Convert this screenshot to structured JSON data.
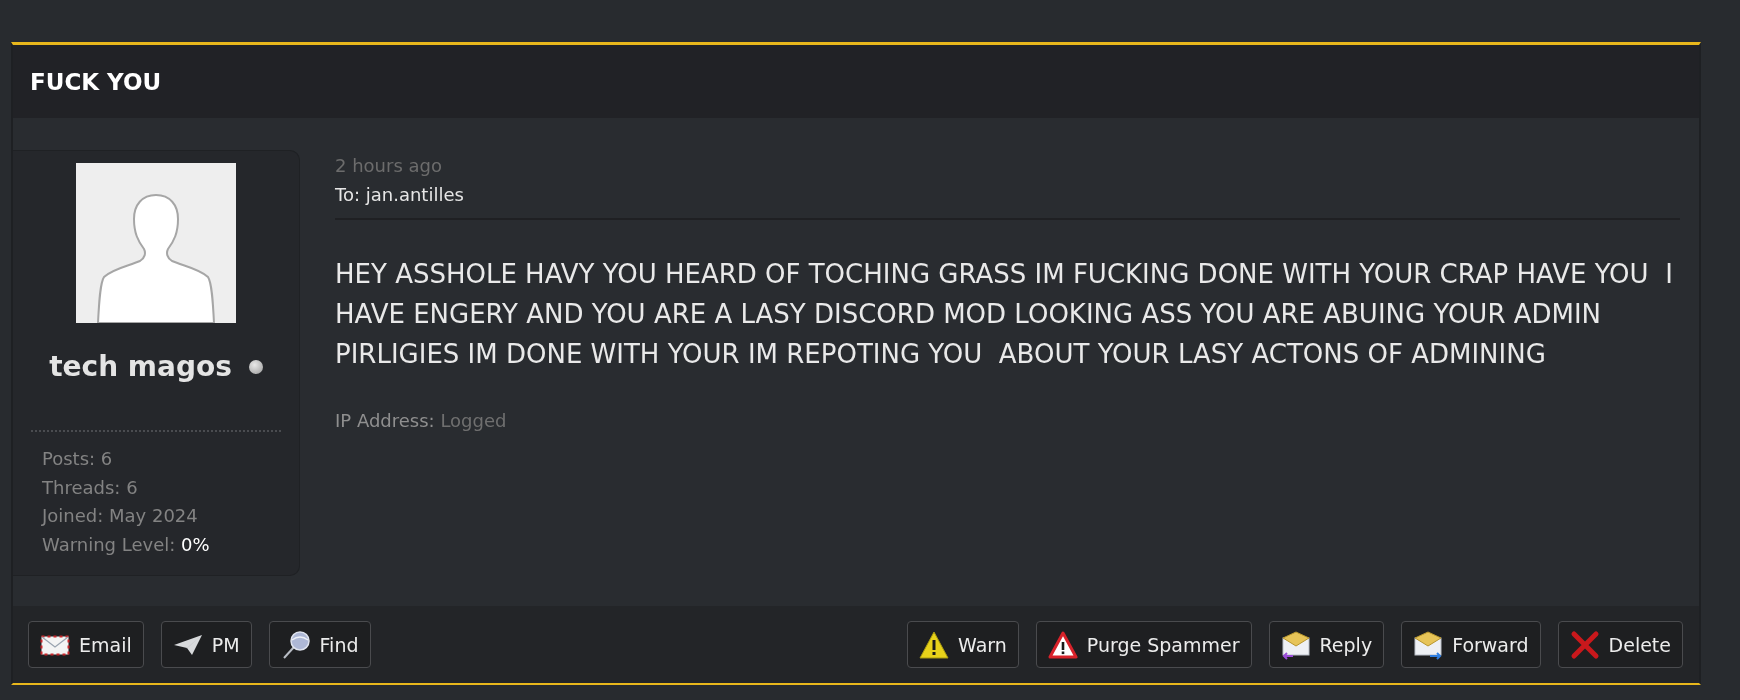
{
  "thread": {
    "title": "FUCK YOU"
  },
  "author": {
    "name": "tech magos",
    "online": false,
    "stats": [
      {
        "label": "Posts:",
        "value": "6"
      },
      {
        "label": "Threads:",
        "value": "6"
      },
      {
        "label": "Joined:",
        "value": "May 2024"
      }
    ],
    "warning_level": {
      "label": "Warning Level:",
      "value": "0%"
    }
  },
  "message": {
    "time": "2 hours ago",
    "recipient": "To: jan.antilles",
    "body": "HEY ASSHOLE HAVY YOU HEARD OF TOCHING GRASS IM FUCKING DONE WITH YOUR CRAP HAVE YOU  I HAVE ENGERY AND YOU ARE A LASY DISCORD MOD LOOKING ASS YOU ARE ABUING YOUR ADMIN PIRLIGIES IM DONE WITH YOUR IM REPOTING YOU  ABOUT YOUR LASY ACTONS OF ADMINING",
    "ip": {
      "label": "IP Address:",
      "value": "Logged"
    }
  },
  "actions_left": [
    {
      "kind": "email",
      "label": "Email"
    },
    {
      "kind": "pm",
      "label": "PM"
    },
    {
      "kind": "find",
      "label": "Find"
    }
  ],
  "actions_right": [
    {
      "kind": "warn",
      "label": "Warn"
    },
    {
      "kind": "purge",
      "label": "Purge Spammer"
    },
    {
      "kind": "reply",
      "label": "Reply"
    },
    {
      "kind": "forward",
      "label": "Forward"
    },
    {
      "kind": "delete",
      "label": "Delete"
    }
  ]
}
